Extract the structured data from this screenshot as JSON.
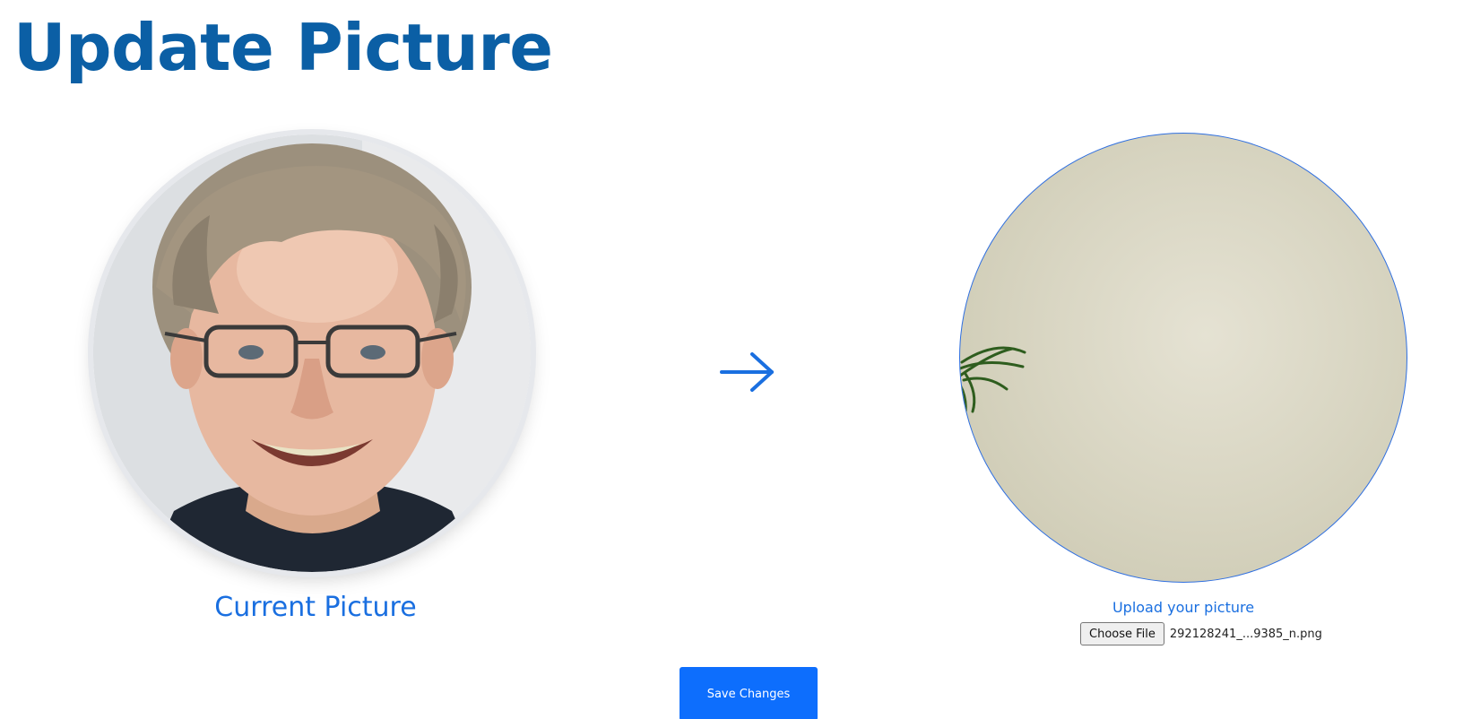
{
  "header": {
    "title": "Update Picture"
  },
  "current": {
    "label": "Current Picture",
    "image_alt": "Current profile picture"
  },
  "arrow": {
    "icon": "arrow-right-icon",
    "color": "#1a6fe0"
  },
  "upload": {
    "label": "Upload your picture",
    "choose_file_label": "Choose File",
    "file_name": "292128241_...9385_n.png"
  },
  "actions": {
    "save_label": "Save Changes"
  },
  "colors": {
    "title": "#0b5fa5",
    "accent": "#1a6fe0",
    "button": "#0d6efd"
  }
}
